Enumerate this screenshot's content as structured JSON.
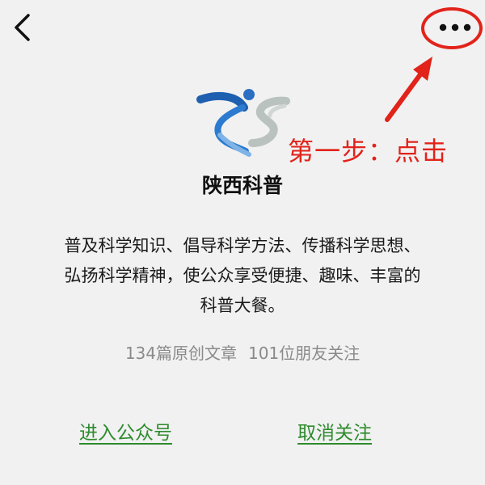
{
  "header": {
    "back_icon": "chevron-left-icon",
    "more_icon": "more-dots-icon"
  },
  "annotation": {
    "step_text": "第一步：点击",
    "color": "#e2231a"
  },
  "account": {
    "name": "陕西科普",
    "description": "普及科学知识、倡导科学方法、传播科学思想、弘扬科学精神，使公众享受便捷、趣味、丰富的科普大餐。",
    "stats": {
      "articles": "134篇原创文章",
      "friends": "101位朋友关注"
    }
  },
  "actions": {
    "enter_label": "进入公众号",
    "unfollow_label": "取消关注",
    "link_color": "#2e8b2e"
  }
}
